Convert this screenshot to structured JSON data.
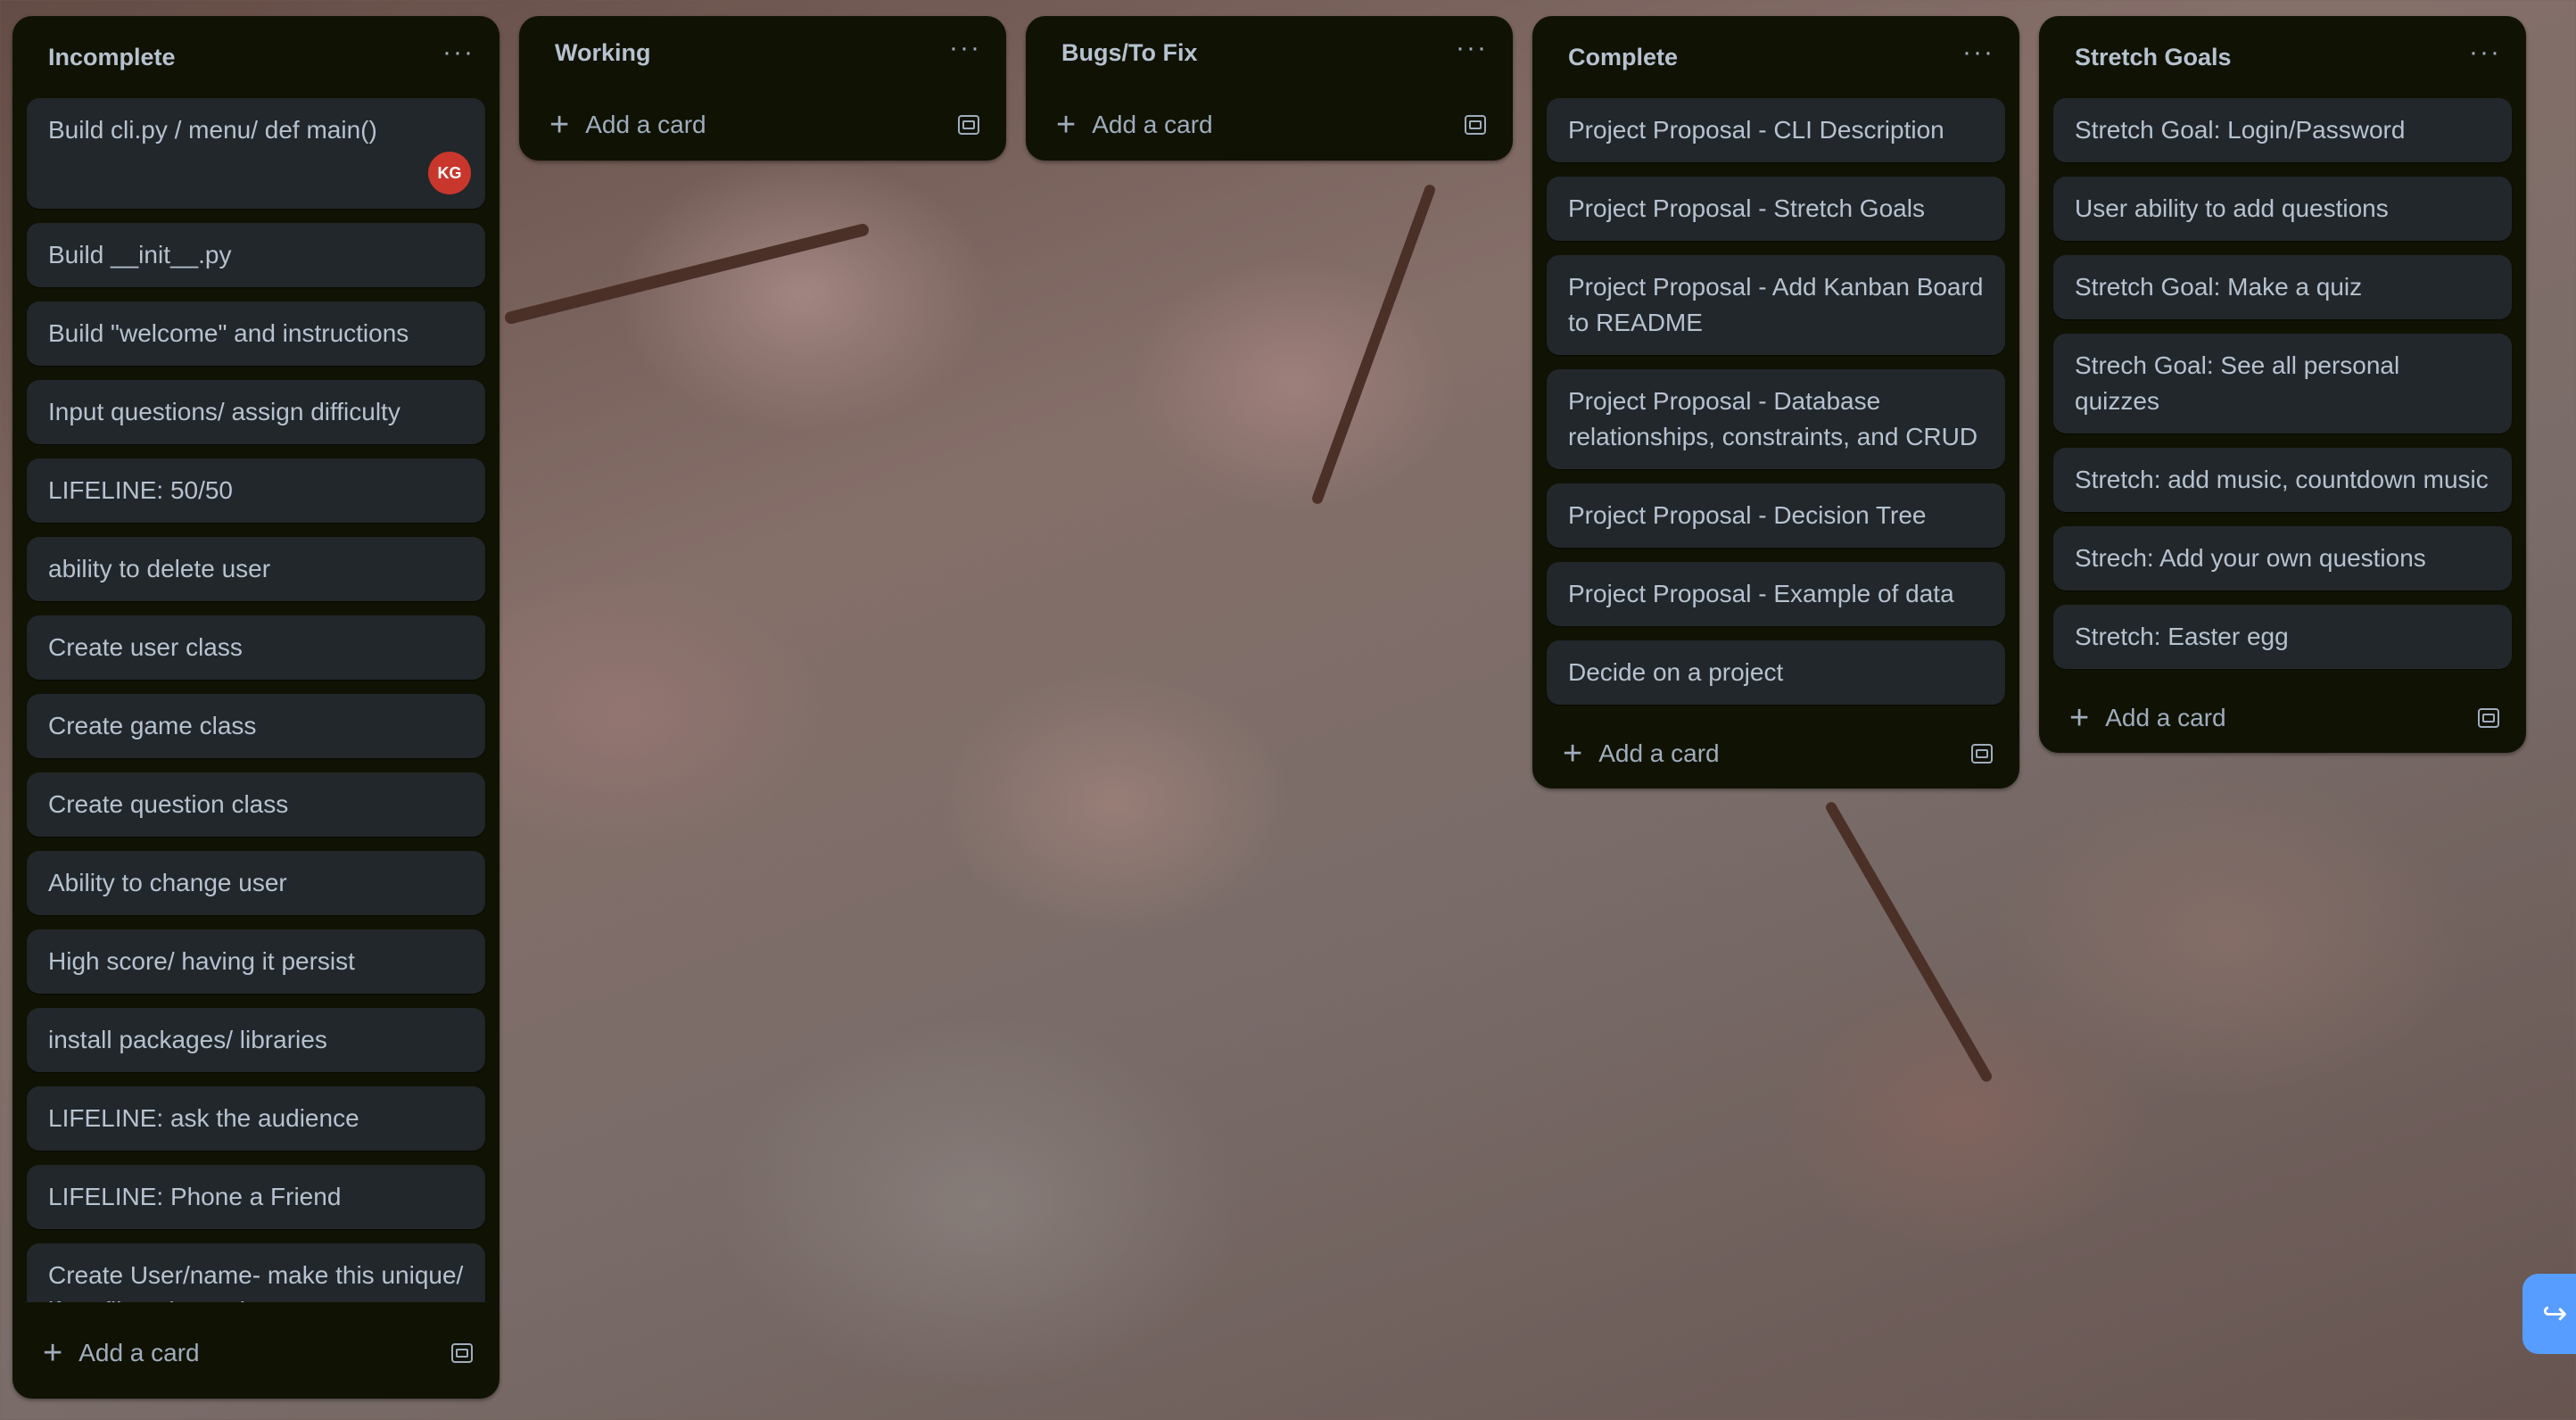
{
  "lists": [
    {
      "title": "Incomplete",
      "menu": "···",
      "cards": [
        "Build cli.py / menu/ def main()",
        "Build __init__.py",
        "Build \"welcome\" and instructions",
        "Input questions/ assign difficulty",
        "LIFELINE: 50/50",
        "ability to delete user",
        "Create user class",
        "Create game class",
        "Create question class",
        "Ability to change user",
        "High score/ having it persist",
        "install packages/ libraries",
        "LIFELINE: ask the audience",
        "LIFELINE: Phone a Friend",
        "Create User/name- make this unique/ if profile exists ask"
      ],
      "first_card_avatar": "KG",
      "add_card": "Add a card"
    },
    {
      "title": "Working",
      "menu": "···",
      "add_card": "Add a card"
    },
    {
      "title": "Bugs/To Fix",
      "menu": "···",
      "add_card": "Add a card"
    },
    {
      "title": "Complete",
      "menu": "···",
      "cards": [
        "Project Proposal - CLI Description",
        "Project Proposal - Stretch Goals",
        "Project Proposal - Add Kanban Board to README",
        "Project Proposal - Database relationships, constraints, and CRUD",
        "Project Proposal - Decision Tree",
        "Project Proposal - Example of data",
        "Decide on a project"
      ],
      "add_card": "Add a card"
    },
    {
      "title": "Stretch Goals",
      "menu": "···",
      "cards": [
        "Stretch Goal: Login/Password",
        "User ability to add questions",
        "Stretch Goal: Make a quiz",
        "Strech Goal: See all personal quizzes",
        "Stretch: add music, countdown music",
        "Strech: Add your own questions",
        "Stretch: Easter egg"
      ],
      "add_card": "Add a card"
    }
  ],
  "colors": {
    "list_bg": "#101204",
    "card_bg": "#22272b",
    "text": "#b6c2cf",
    "avatar": "#c9372c",
    "fab": "#579dff"
  }
}
